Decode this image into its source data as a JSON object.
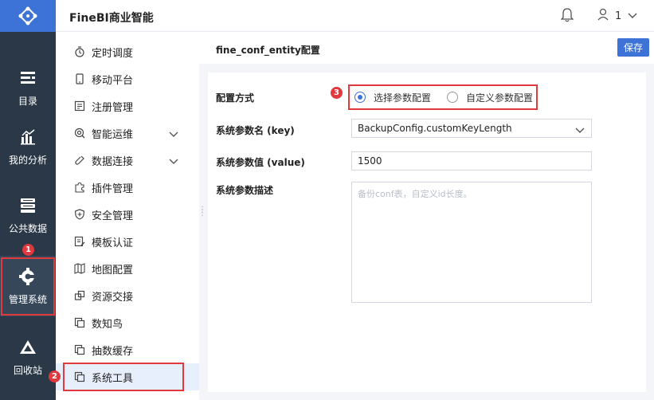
{
  "header": {
    "brand": "FineBI商业智能",
    "user": "1"
  },
  "rail": [
    {
      "label": "目录",
      "icon": "catalog-icon"
    },
    {
      "label": "我的分析",
      "icon": "analysis-icon"
    },
    {
      "label": "公共数据",
      "icon": "database-icon"
    },
    {
      "label": "管理系统",
      "icon": "gear-icon"
    },
    {
      "label": "回收站",
      "icon": "recycle-icon"
    }
  ],
  "sidebar": {
    "items": [
      {
        "label": "定时调度",
        "icon": "timer-icon"
      },
      {
        "label": "移动平台",
        "icon": "mobile-icon"
      },
      {
        "label": "注册管理",
        "icon": "register-icon"
      },
      {
        "label": "智能运维",
        "icon": "maintenance-icon",
        "expandable": true
      },
      {
        "label": "数据连接",
        "icon": "link-icon",
        "expandable": true
      },
      {
        "label": "插件管理",
        "icon": "plugin-icon"
      },
      {
        "label": "安全管理",
        "icon": "shield-icon"
      },
      {
        "label": "模板认证",
        "icon": "template-icon"
      },
      {
        "label": "地图配置",
        "icon": "map-icon"
      },
      {
        "label": "资源交接",
        "icon": "resource-icon"
      },
      {
        "label": "数知鸟",
        "icon": "copy-icon"
      },
      {
        "label": "抽数缓存",
        "icon": "copy-icon"
      },
      {
        "label": "系统工具",
        "icon": "copy-icon",
        "active": true
      }
    ]
  },
  "main": {
    "breadcrumb": "fine_conf_entity配置",
    "save_label": "保存",
    "form": {
      "mode_label": "配置方式",
      "mode_options": [
        "选择参数配置",
        "自定义参数配置"
      ],
      "mode_selected": "选择参数配置",
      "key_label": "系统参数名 (key)",
      "key_value": "BackupConfig.customKeyLength",
      "value_label": "系统参数值 (value)",
      "value_value": "1500",
      "desc_label": "系统参数描述",
      "desc_placeholder": "备份conf表，自定义id长度。"
    }
  },
  "badges": [
    "1",
    "2",
    "3"
  ],
  "colors": {
    "accent": "#3d73d6",
    "rail_bg": "#2b3847",
    "highlight": "#e0393e"
  }
}
